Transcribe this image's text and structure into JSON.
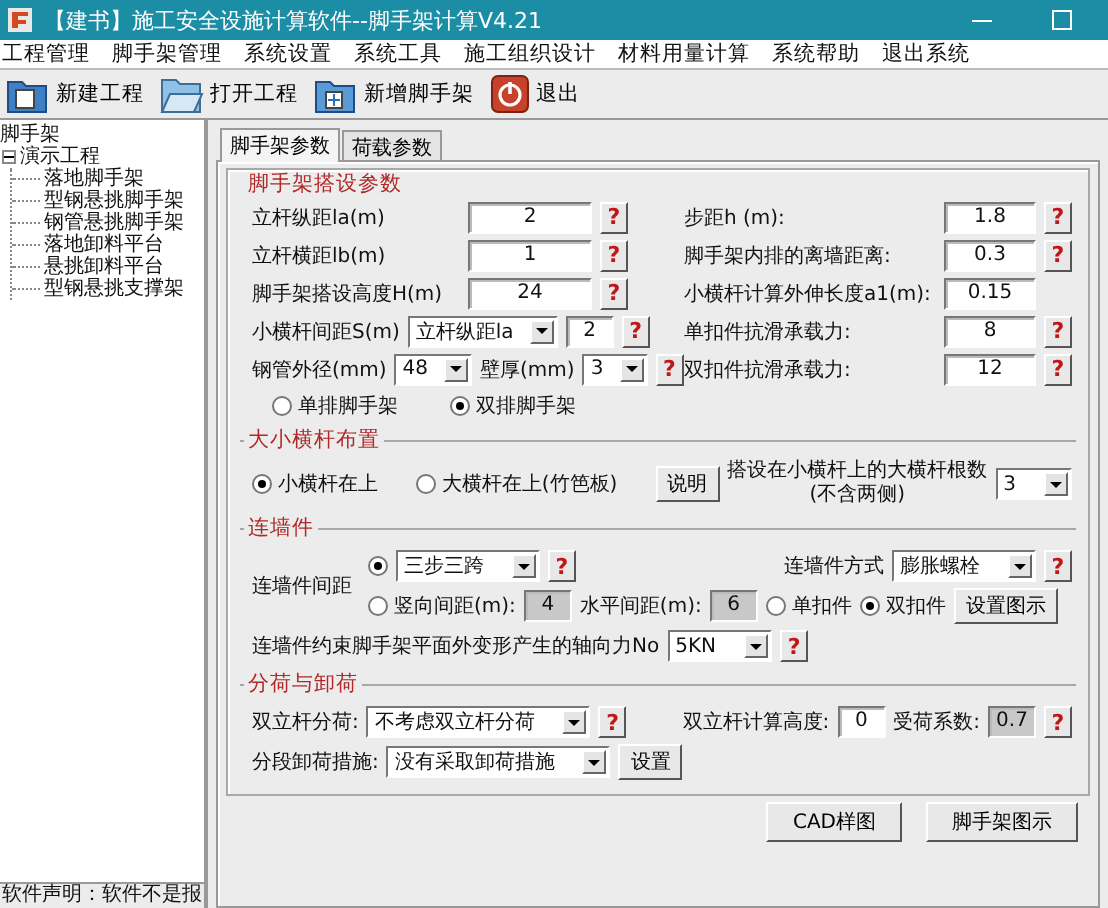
{
  "window": {
    "title": "【建书】施工安全设施计算软件--脚手架计算V4.21"
  },
  "menu": [
    {
      "label": "工程管理"
    },
    {
      "label": "脚手架管理"
    },
    {
      "label": "系统设置"
    },
    {
      "label": "系统工具"
    },
    {
      "label": "施工组织设计"
    },
    {
      "label": "材料用量计算"
    },
    {
      "label": "系统帮助"
    },
    {
      "label": "退出系统"
    }
  ],
  "toolbar": [
    {
      "label": "新建工程",
      "kind": "new"
    },
    {
      "label": "打开工程",
      "kind": "open"
    },
    {
      "label": "新增脚手架",
      "kind": "add"
    },
    {
      "label": "退出",
      "kind": "exit"
    }
  ],
  "tree": {
    "label": "脚手架",
    "children": [
      {
        "label": "演示工程",
        "expanded": true,
        "children": [
          {
            "label": "落地脚手架"
          },
          {
            "label": "型钢悬挑脚手架"
          },
          {
            "label": "钢管悬挑脚手架"
          },
          {
            "label": "落地卸料平台"
          },
          {
            "label": "悬挑卸料平台"
          },
          {
            "label": "型钢悬挑支撑架"
          }
        ]
      }
    ]
  },
  "status": "软件声明：软件不是报",
  "tabs": [
    {
      "label": "脚手架参数",
      "selected": true
    },
    {
      "label": "荷载参数",
      "selected": false
    }
  ],
  "sections": [
    {
      "kind": "params",
      "title": "脚手架搭设参数",
      "left": [
        {
          "kind": "field",
          "parts": [
            {
              "kind": "label",
              "text": "立杆纵距la(m)"
            },
            {
              "kind": "input",
              "value": "2"
            },
            {
              "kind": "help",
              "text": "?"
            }
          ]
        },
        {
          "kind": "field",
          "parts": [
            {
              "kind": "label",
              "text": "立杆横距lb(m)"
            },
            {
              "kind": "input",
              "value": "1"
            },
            {
              "kind": "help",
              "text": "?"
            }
          ]
        },
        {
          "kind": "field",
          "parts": [
            {
              "kind": "label",
              "text": "脚手架搭设高度H(m)"
            },
            {
              "kind": "input",
              "value": "24"
            },
            {
              "kind": "help",
              "text": "?"
            }
          ]
        },
        {
          "kind": "compound",
          "parts": [
            {
              "kind": "label",
              "text": "小横杆间距S(m)"
            },
            {
              "kind": "select",
              "value": "立杆纵距la"
            },
            {
              "kind": "input",
              "value": "2"
            },
            {
              "kind": "help",
              "text": "?"
            }
          ]
        },
        {
          "kind": "compound",
          "parts": [
            {
              "kind": "label",
              "text": "钢管外径(mm)"
            },
            {
              "kind": "select",
              "value": "48"
            },
            {
              "kind": "label",
              "text": "壁厚(mm)"
            },
            {
              "kind": "select",
              "value": "3"
            },
            {
              "kind": "help",
              "text": "?"
            }
          ]
        }
      ],
      "right": [
        {
          "kind": "field",
          "parts": [
            {
              "kind": "label",
              "text": "步距h (m):"
            },
            {
              "kind": "input",
              "value": "1.8"
            },
            {
              "kind": "help",
              "text": "?"
            }
          ]
        },
        {
          "kind": "field",
          "parts": [
            {
              "kind": "label",
              "text": "脚手架内排的离墙距离:"
            },
            {
              "kind": "input",
              "value": "0.3"
            },
            {
              "kind": "help",
              "text": "?"
            }
          ]
        },
        {
          "kind": "field",
          "parts": [
            {
              "kind": "label",
              "text": "小横杆计算外伸长度a1(m):"
            },
            {
              "kind": "input",
              "value": "0.15"
            }
          ]
        },
        {
          "kind": "field",
          "parts": [
            {
              "kind": "label",
              "text": "单扣件抗滑承载力:"
            },
            {
              "kind": "input",
              "value": "8"
            },
            {
              "kind": "help",
              "text": "?"
            }
          ]
        },
        {
          "kind": "field",
          "parts": [
            {
              "kind": "label",
              "text": "双扣件抗滑承载力:"
            },
            {
              "kind": "input",
              "value": "12"
            },
            {
              "kind": "help",
              "text": "?"
            }
          ]
        }
      ],
      "options": [
        {
          "kind": "radio",
          "label": "单排脚手架",
          "selected": false
        },
        {
          "kind": "radio",
          "label": "双排脚手架",
          "selected": true
        }
      ]
    },
    {
      "kind": "flow",
      "title": "大小横杆布置",
      "rows": [
        {
          "kind": "flow",
          "clusters": [
            [
              {
                "kind": "radio",
                "label": "小横杆在上",
                "selected": true
              }
            ],
            [
              {
                "kind": "radio",
                "label": "大横杆在上(竹笆板)",
                "selected": false
              }
            ],
            [
              {
                "kind": "button",
                "label": "说明"
              },
              {
                "kind": "label",
                "lines": [
                  "搭设在小横杆上的大横杆根数",
                  "(不含两侧)"
                ]
              },
              {
                "kind": "select",
                "value": "3"
              }
            ]
          ]
        }
      ]
    },
    {
      "kind": "flow",
      "title": "连墙件",
      "rows": [
        {
          "kind": "span",
          "label": "连墙件间距",
          "lines": [
            {
              "clusters": [
                [
                  {
                    "kind": "radio",
                    "selected": true
                  },
                  {
                    "kind": "select",
                    "value": "三步三跨"
                  },
                  {
                    "kind": "help",
                    "text": "?"
                  }
                ],
                [
                  {
                    "kind": "label",
                    "text": "连墙件方式"
                  },
                  {
                    "kind": "select",
                    "value": "膨胀螺栓"
                  },
                  {
                    "kind": "help",
                    "text": "?"
                  }
                ]
              ]
            },
            {
              "clusters": [
                [
                  {
                    "kind": "radio",
                    "label": "竖向间距(m):",
                    "selected": false
                  },
                  {
                    "kind": "input",
                    "value": "4",
                    "disabled": true
                  },
                  {
                    "kind": "label",
                    "text": "水平间距(m):"
                  },
                  {
                    "kind": "input",
                    "value": "6",
                    "disabled": true
                  },
                  {
                    "kind": "radio",
                    "label": "单扣件",
                    "selected": false
                  },
                  {
                    "kind": "radio",
                    "label": "双扣件",
                    "selected": true
                  },
                  {
                    "kind": "button",
                    "label": "设置图示"
                  }
                ]
              ]
            }
          ]
        },
        {
          "kind": "flow",
          "clusters": [
            [
              {
                "kind": "label",
                "text": "连墙件约束脚手架平面外变形产生的轴向力No"
              },
              {
                "kind": "select",
                "value": "5KN"
              },
              {
                "kind": "help",
                "text": "?"
              }
            ]
          ]
        }
      ]
    },
    {
      "kind": "flow",
      "title": "分荷与卸荷",
      "rows": [
        {
          "kind": "flow",
          "clusters": [
            [
              {
                "kind": "label",
                "text": "双立杆分荷:"
              },
              {
                "kind": "select",
                "value": "不考虑双立杆分荷"
              },
              {
                "kind": "help",
                "text": "?"
              }
            ],
            [
              {
                "kind": "label",
                "text": "双立杆计算高度:"
              },
              {
                "kind": "input",
                "value": "0"
              },
              {
                "kind": "label",
                "text": "受荷系数:"
              },
              {
                "kind": "input",
                "value": "0.7",
                "disabled": true
              },
              {
                "kind": "help",
                "text": "?"
              }
            ]
          ]
        },
        {
          "kind": "flow",
          "clusters": [
            [
              {
                "kind": "label",
                "text": "分段卸荷措施:"
              },
              {
                "kind": "select",
                "value": "没有采取卸荷措施"
              },
              {
                "kind": "button",
                "label": "设置"
              }
            ]
          ]
        }
      ]
    }
  ],
  "buttons": [
    {
      "label": "CAD样图"
    },
    {
      "label": "脚手架图示"
    }
  ]
}
